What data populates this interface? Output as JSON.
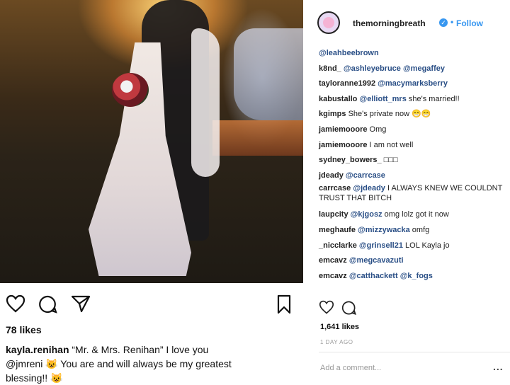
{
  "post": {
    "likes": "78 likes",
    "caption_user": "kayla.renihan",
    "caption_text_1": "“Mr. & Mrs. Renihan” I love you",
    "caption_text_2": "@jmreni 😺 You are and will always be my greatest",
    "caption_text_3": "blessing!! 😺"
  },
  "right_panel": {
    "username": "themorningbreath",
    "follow": "Follow",
    "comments": [
      {
        "u": "",
        "m": "@leahbeebrown",
        "t": ""
      },
      {
        "u": "k8nd_",
        "m": "@ashleyebruce @megaffey",
        "t": ""
      },
      {
        "u": "tayloranne1992",
        "m": "@macymarksberry",
        "t": ""
      },
      {
        "u": "kabustallo",
        "m": "@elliott_mrs",
        "t": " she's married!!"
      },
      {
        "u": "kgimps",
        "m": "",
        "t": " She's private now 😁😁"
      },
      {
        "u": "jamiemooore",
        "m": "",
        "t": " Omg"
      },
      {
        "u": "jamiemooore",
        "m": "",
        "t": " I am not well"
      },
      {
        "u": "sydney_bowers_",
        "m": "",
        "t": " □□□"
      },
      {
        "u": "jdeady",
        "m": "@carrcase",
        "t": ""
      },
      {
        "u": "carrcase",
        "m": "@jdeady",
        "t": " I ALWAYS KNEW WE COULDNT TRUST THAT BITCH"
      },
      {
        "u": "laupcity",
        "m": "@kjgosz",
        "t": " omg lolz got it now"
      },
      {
        "u": "meghaufe",
        "m": "@mizzywacka",
        "t": " omfg"
      },
      {
        "u": "_nicclarke",
        "m": "@grinsell21",
        "t": " LOL Kayla jo"
      },
      {
        "u": "emcavz",
        "m": "@megcavazuti",
        "t": ""
      },
      {
        "u": "emcavz",
        "m": "@catthackett @k_fogs",
        "t": ""
      }
    ],
    "likes": "1,641 likes",
    "date": "1 DAY AGO",
    "add_comment": "Add a comment...",
    "more": "..."
  },
  "icons": [
    "heart-icon",
    "comment-icon",
    "share-icon",
    "bookmark-icon",
    "verified-icon"
  ],
  "colors": {
    "link": "#3897f0",
    "mention": "#2a4f86"
  }
}
